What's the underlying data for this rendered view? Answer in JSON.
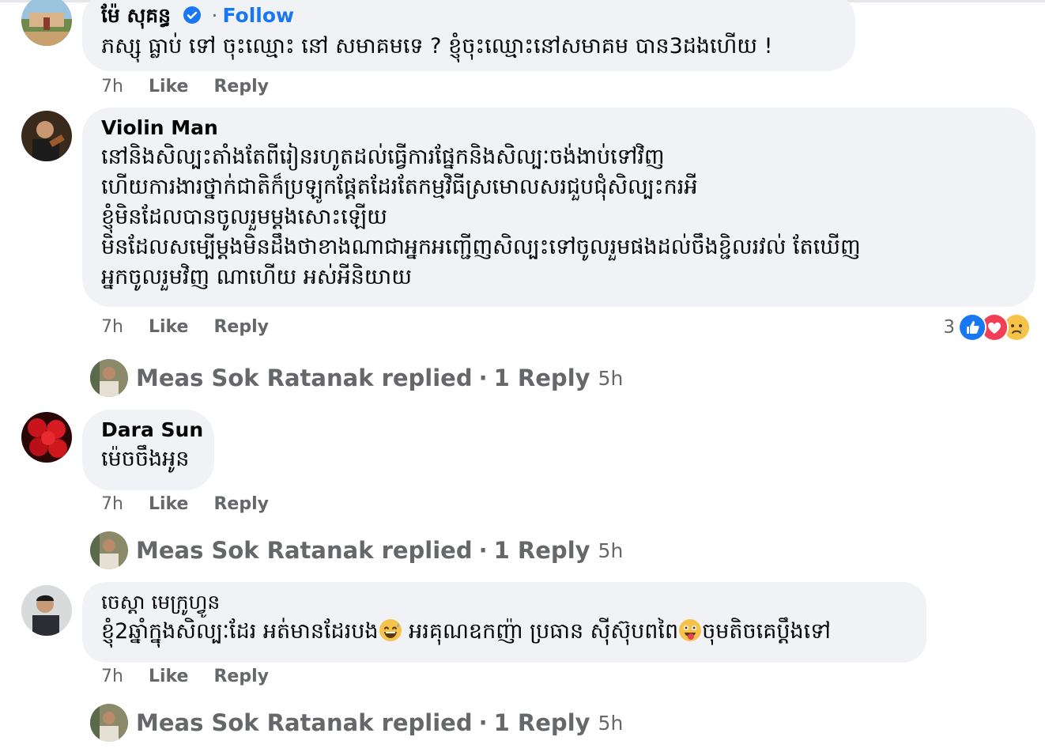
{
  "comments": [
    {
      "author": "ម៉ែ សុគន្ធ",
      "follow_separator": "·",
      "follow_label": "Follow",
      "text": "ភស្សុ ធ្លាប់ ទៅ ចុះឈ្មោះ នៅ សមាគមទេ ? ខ្ញុំចុះឈ្មោះនៅសមាគម បាន3ដងហើយ !",
      "time": "7h",
      "like_label": "Like",
      "reply_label": "Reply"
    },
    {
      "author": "Violin Man",
      "text_lines": [
        "នៅនិងសិល្បះតាំងតែពីរៀនរហូតដល់ធ្វើការផ្នែកនិងសិល្បៈចង់ងាប់ទៅវិញ",
        "ហើយការងារថ្នាក់ជាតិក៏ប្រឡូកផ្ដែតដែរតែកម្មវិធីស្រមោលសរជួបជុំសិល្បះករអី",
        "ខ្ញុំមិនដែលបានចូលរួមម្ដងសោះឡើយ",
        "មិនដែលសម្បើម្ដងមិនដឹងថាខាងណាជាអ្នកអញ្ជើញសិល្បះទៅចូលរួមផងដល់ចឹងខ្ជិលរវល់ តែឃើញ",
        "អ្នកចូលរួមវិញ ណាហើយ អស់អីនិយាយ"
      ],
      "time": "7h",
      "like_label": "Like",
      "reply_label": "Reply",
      "reaction_count": "3",
      "reactions": [
        "like-icon",
        "love-icon",
        "sad-icon"
      ],
      "replies": {
        "label": "Meas Sok Ratanak replied",
        "sep": "·",
        "count": "1 Reply",
        "time": "5h"
      }
    },
    {
      "author": "Dara Sun",
      "text": "ម៉េចចឹងអូន",
      "time": "7h",
      "like_label": "Like",
      "reply_label": "Reply",
      "replies": {
        "label": "Meas Sok Ratanak replied",
        "sep": "·",
        "count": "1 Reply",
        "time": "5h"
      }
    },
    {
      "author": "ចេស្តា មេក្រូហ្វូន",
      "text_part1": "ខ្ញុំ2ឆ្នាំក្នុងសិល្បៈដែរ អត់មានដែរបង",
      "text_part2": " អរគុណឧកញ៉ា ប្រធាន ស៊ីស៊ុបពពៃ",
      "text_part3": "ចុមតិចគេប្ដឹងទៅ",
      "time": "7h",
      "like_label": "Like",
      "reply_label": "Reply",
      "replies": {
        "label": "Meas Sok Ratanak replied",
        "sep": "·",
        "count": "1 Reply",
        "time": "5h"
      }
    }
  ],
  "colors": {
    "bubble": "#f0f2f5",
    "link_blue": "#1877f2",
    "meta_gray": "#65676b",
    "text": "#050505"
  }
}
